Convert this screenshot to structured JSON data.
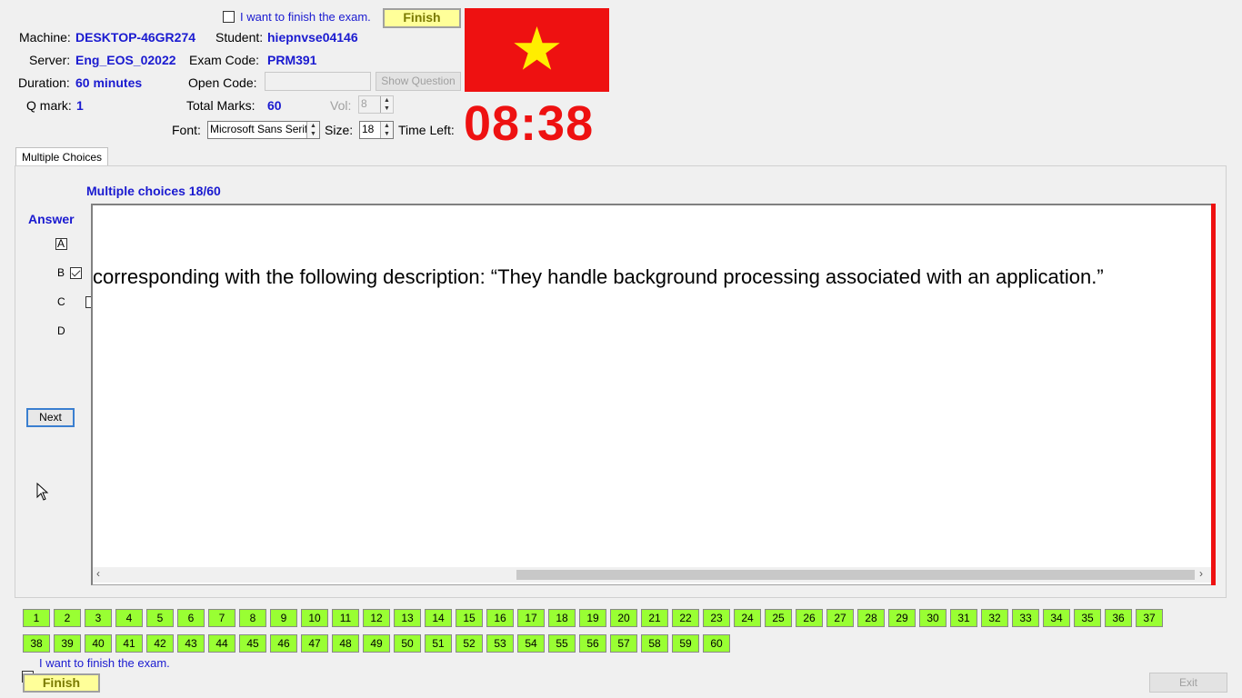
{
  "header": {
    "finish_checkbox_label": "I want to finish the exam.",
    "finish_button": "Finish",
    "machine_label": "Machine:",
    "machine_value": "DESKTOP-46GR274",
    "student_label": "Student:",
    "student_value": "hiepnvse04146",
    "server_label": "Server:",
    "server_value": "Eng_EOS_02022",
    "exam_code_label": "Exam Code:",
    "exam_code_value": "PRM391",
    "duration_label": "Duration:",
    "duration_value": "60 minutes",
    "open_code_label": "Open Code:",
    "open_code_value": "",
    "show_question_button": "Show Question",
    "qmark_label": "Q mark:",
    "qmark_value": "1",
    "total_marks_label": "Total Marks:",
    "total_marks_value": "60",
    "vol_label": "Vol:",
    "vol_value": "8",
    "font_label": "Font:",
    "font_value": "Microsoft Sans Serif",
    "size_label": "Size:",
    "size_value": "18",
    "time_left_label": "Time Left:",
    "time_left_value": "08:38",
    "flag_colors": {
      "background": "#ee1111",
      "star": "#ffee00"
    }
  },
  "tab": {
    "label": "Multiple Choices"
  },
  "question": {
    "heading": "Multiple choices 18/60",
    "text": "corresponding with the following description: “They handle background processing associated with an application.”"
  },
  "answer": {
    "heading": "Answer",
    "options": [
      {
        "label": "A",
        "checked": false
      },
      {
        "label": "B",
        "checked": true
      },
      {
        "label": "C",
        "checked": false
      },
      {
        "label": "D",
        "checked": false
      }
    ],
    "next_button": "Next"
  },
  "question_numbers": {
    "row1": [
      "1",
      "2",
      "3",
      "4",
      "5",
      "6",
      "7",
      "8",
      "9",
      "10",
      "11",
      "12",
      "13",
      "14",
      "15",
      "16",
      "17",
      "18",
      "19",
      "20",
      "21",
      "22",
      "23",
      "24",
      "25",
      "26",
      "27",
      "28",
      "29",
      "30",
      "31",
      "32",
      "33",
      "34",
      "35",
      "36",
      "37"
    ],
    "row2": [
      "38",
      "39",
      "40",
      "41",
      "42",
      "43",
      "44",
      "45",
      "46",
      "47",
      "48",
      "49",
      "50",
      "51",
      "52",
      "53",
      "54",
      "55",
      "56",
      "57",
      "58",
      "59",
      "60"
    ],
    "color": "#99ff33"
  },
  "footer": {
    "finish_checkbox_label": "I want to finish the exam.",
    "finish_button": "Finish",
    "exit_button": "Exit"
  }
}
